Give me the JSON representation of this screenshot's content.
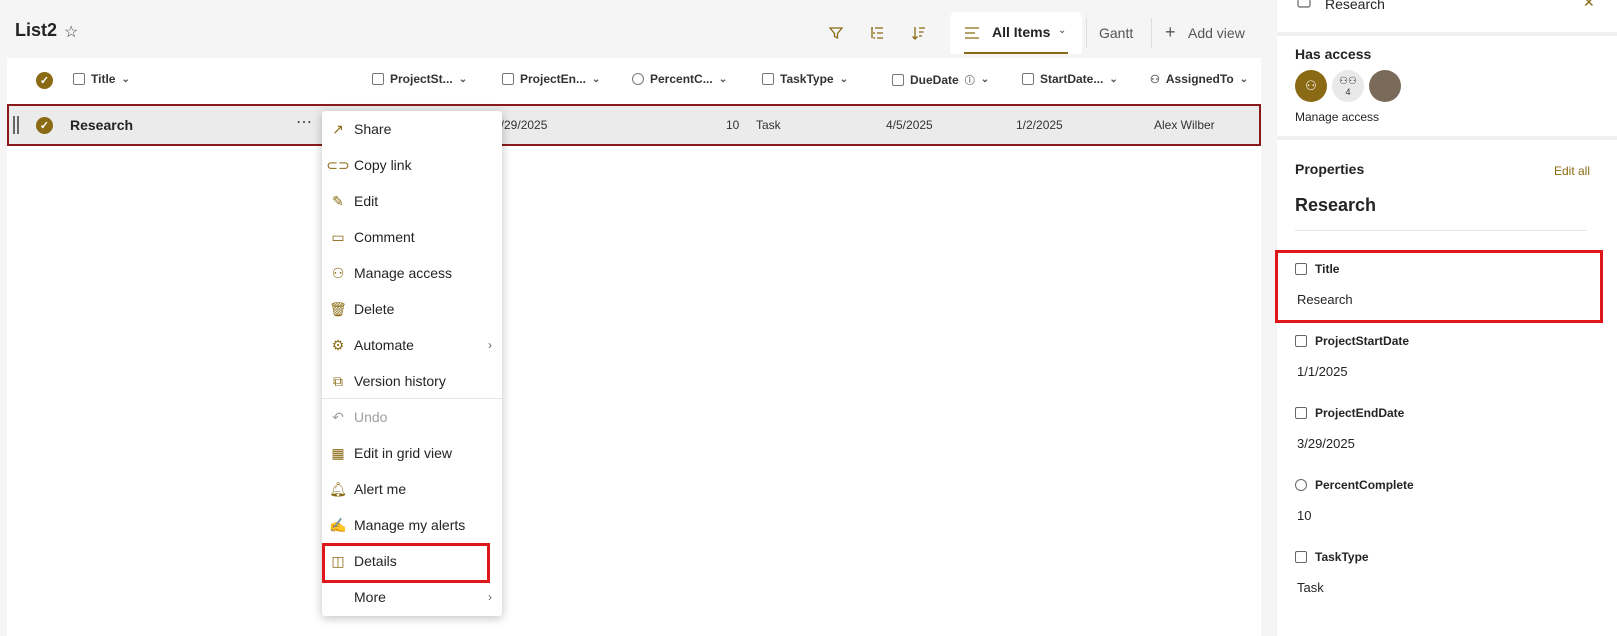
{
  "header": {
    "list_name": "List2",
    "view_name": "All Items",
    "gantt_label": "Gantt",
    "add_view_label": "Add view"
  },
  "columns": [
    {
      "label": "Title"
    },
    {
      "label": "ProjectSt..."
    },
    {
      "label": "ProjectEn..."
    },
    {
      "label": "PercentC..."
    },
    {
      "label": "TaskType"
    },
    {
      "label": "DueDate"
    },
    {
      "label": "StartDate..."
    },
    {
      "label": "AssignedTo"
    }
  ],
  "row": {
    "title": "Research",
    "project_end": "3/29/2025",
    "percent_complete": "10",
    "task_type": "Task",
    "due_date": "4/5/2025",
    "start_date": "1/2/2025",
    "assigned_to": "Alex Wilber"
  },
  "context_menu": {
    "items": [
      {
        "label": "Share",
        "icon": "share-icon"
      },
      {
        "label": "Copy link",
        "icon": "link-icon"
      },
      {
        "label": "Edit",
        "icon": "pencil-icon"
      },
      {
        "label": "Comment",
        "icon": "comment-icon"
      },
      {
        "label": "Manage access",
        "icon": "person-icon"
      },
      {
        "label": "Delete",
        "icon": "trash-icon"
      },
      {
        "label": "Automate",
        "icon": "automate-icon"
      },
      {
        "label": "Version history",
        "icon": "history-icon"
      },
      {
        "label": "Undo",
        "icon": "undo-icon"
      },
      {
        "label": "Edit in grid view",
        "icon": "grid-icon"
      },
      {
        "label": "Alert me",
        "icon": "bell-icon"
      },
      {
        "label": "Manage my alerts",
        "icon": "alerts-icon"
      },
      {
        "label": "Details",
        "icon": "details-icon"
      },
      {
        "label": "More",
        "icon": ""
      }
    ]
  },
  "pane": {
    "top_title": "Research",
    "has_access_label": "Has access",
    "access_count": "4",
    "manage_access_link": "Manage access",
    "properties_label": "Properties",
    "edit_all_link": "Edit all",
    "item_title": "Research",
    "props": [
      {
        "label": "Title",
        "value": "Research"
      },
      {
        "label": "ProjectStartDate",
        "value": "1/1/2025"
      },
      {
        "label": "ProjectEndDate",
        "value": "3/29/2025"
      },
      {
        "label": "PercentComplete",
        "value": "10"
      },
      {
        "label": "TaskType",
        "value": "Task"
      }
    ]
  },
  "colors": {
    "accent": "#8a6a14",
    "highlight": "#e0171a"
  }
}
